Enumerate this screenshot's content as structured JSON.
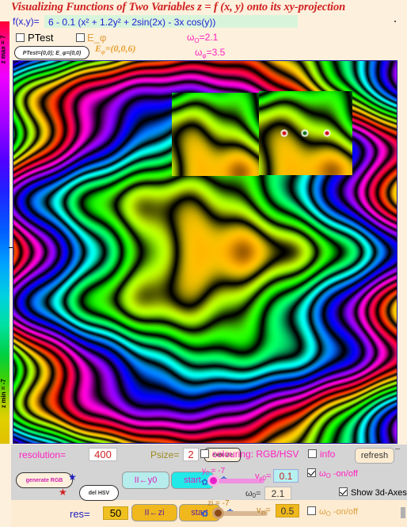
{
  "header": {
    "title": "Visualizing Functions of Two Variables z = f (x, y) onto its xy-projection",
    "fxy_label": "f(x,y)=",
    "formula": "6 - 0.1 (x² + 1.2y² + 2sin(2x) - 3x cos(y))"
  },
  "colorbar": {
    "top_label": "z max = 7",
    "bottom_label": "z min = -7"
  },
  "options": {
    "ptest_label": "PTest",
    "ptest_checked": false,
    "ephi_label": "E_φ",
    "ephi_checked": false,
    "ptest_readout": "PTest=(0,0); E_φ=(0,0)",
    "ephi_value_main": "E",
    "ephi_value_sub": "φ",
    "ephi_value_rest": "=(0,0,6)"
  },
  "omegas": {
    "omega_o_name": "ω",
    "omega_o_sub": "O",
    "omega_o_eq": "=2.1",
    "omega_phi_name": "ω",
    "omega_phi_sub": "φ",
    "omega_phi_eq": "=3.5"
  },
  "controls": {
    "resolution_label": "resolution=",
    "resolution_value": "400",
    "psize_label": "Psize=",
    "psize_value": "2",
    "execute_label": "execute",
    "generate_rgb_label": "generate RGB",
    "del_hsv_label": "del HSV",
    "star_blue": "★",
    "star_red": "★",
    "res_label": "res=",
    "res_value": "50",
    "y0_btn_label": "II←y0",
    "y0_start_label": "start",
    "zi_btn_label": "II←zi",
    "zi_start_label": "start",
    "gear_glyph": "✿"
  },
  "checkboxes": {
    "colouring_label": "colouring: RGB/HSV",
    "colouring_checked": false,
    "info_label": "info",
    "info_checked": false,
    "refresh_label": "refresh",
    "omega_onoff_1_name": "ω",
    "omega_onoff_1_sub": "O",
    "omega_onoff_1_rest": " -on/off",
    "omega_onoff_1_checked": true,
    "omega_onoff_2_name": "ω",
    "omega_onoff_2_sub": "O",
    "omega_onoff_2_rest": " -on/off",
    "omega_onoff_2_checked": false,
    "show_3d_axes_label": "Show 3d-Axes",
    "show_3d_axes_checked": true
  },
  "sliders": {
    "y0_caption_name": "y",
    "y0_caption_sub": "0",
    "y0_caption_rest": " = -7",
    "vy0_name": "v",
    "vy0_sub": "y0",
    "vy0_eq": "=",
    "vy0_value": "0.1",
    "omega0_name": "ω",
    "omega0_sub": "0",
    "omega0_eq": "=",
    "omega0_value": "2.1",
    "zi_caption": "zi = -7",
    "vzi_name": "v",
    "vzi_sub": "zi",
    "vzi_eq": "=",
    "vzi_value": "0.5"
  }
}
